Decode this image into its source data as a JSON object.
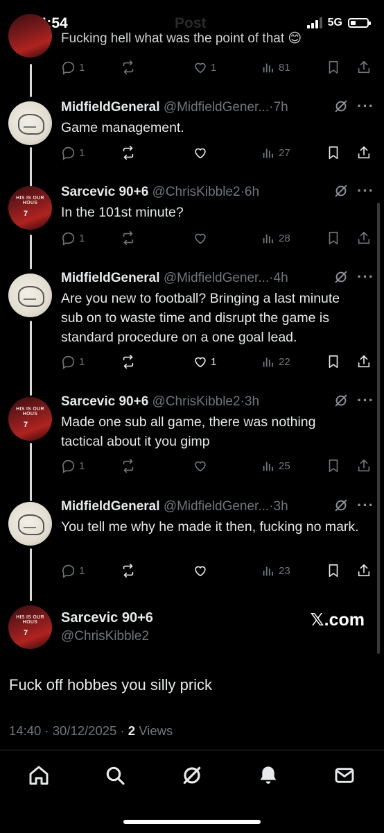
{
  "status_bar": {
    "time": "14:54",
    "network": "5G"
  },
  "header_ghost": {
    "title": "Post"
  },
  "top_tweet": {
    "cut_text": "Fucking hell what was the point of that 😊",
    "replies": "1",
    "reposts": "",
    "likes": "1",
    "views": "81"
  },
  "replies": [
    {
      "name": "MidfieldGeneral",
      "handle": "@MidfieldGener...",
      "time": "7h",
      "text": "Game management.",
      "replies": "1",
      "reposts": "",
      "likes": "",
      "views": "27"
    },
    {
      "name": "Sarcevic 90+6",
      "handle": "@ChrisKibble2",
      "time": "6h",
      "text": "In the 101st minute?",
      "replies": "1",
      "reposts": "",
      "likes": "",
      "views": "28"
    },
    {
      "name": "MidfieldGeneral",
      "handle": "@MidfieldGener...",
      "time": "4h",
      "text": "Are you new to football? Bringing a last minute sub on to waste time and disrupt the game is standard procedure on a one goal lead.",
      "replies": "1",
      "reposts": "",
      "likes": "1",
      "views": "22"
    },
    {
      "name": "Sarcevic 90+6",
      "handle": "@ChrisKibble2",
      "time": "3h",
      "text": "Made one sub all game, there was nothing tactical about it you gimp",
      "replies": "1",
      "reposts": "",
      "likes": "",
      "views": "25"
    },
    {
      "name": "MidfieldGeneral",
      "handle": "@MidfieldGener...",
      "time": "3h",
      "text": "You tell me why he made it then, fucking no mark.",
      "replies": "1",
      "reposts": "",
      "likes": "",
      "views": "23"
    }
  ],
  "main_tweet": {
    "name": "Sarcevic 90+6",
    "handle": "@ChrisKibble2",
    "watermark": "𝕏.com",
    "text": "Fuck off hobbes you silly prick",
    "timestamp": "14:40 · 30/12/2025 · ",
    "views_count": "2",
    "views_label": " Views"
  },
  "avatar_banner": "HIS IS OUR HOUS",
  "avatar_number": "7",
  "dot": "·",
  "more_glyph": "···",
  "colors": {
    "background": "#000000",
    "text": "#e7e9ea",
    "muted": "#71767b",
    "line": "#d7d9da"
  },
  "tab_bar": [
    "home-icon",
    "search-icon",
    "grok-icon",
    "notifications-icon",
    "messages-icon"
  ]
}
